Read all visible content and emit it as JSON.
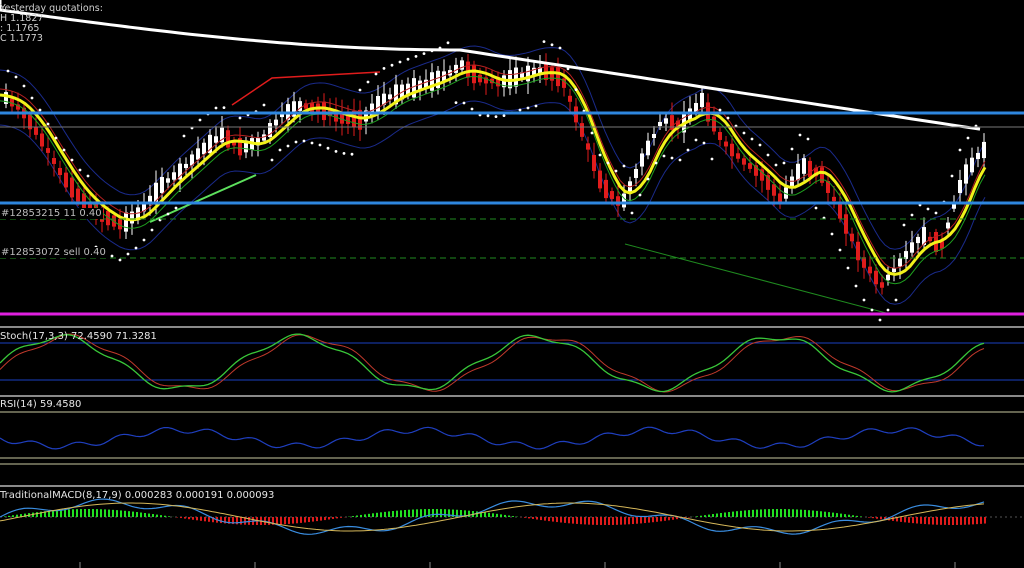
{
  "quotations": {
    "title": "Yesterday quotations:",
    "high": "H 1.1827",
    "low": ": 1.1765",
    "close": "C 1.1773"
  },
  "orders": [
    {
      "id": "#12853215",
      "side_label": "#12853215",
      "suffix": "11 0.40",
      "color": "#1f8a1f"
    },
    {
      "id": "#12853072",
      "side_label": "#12853072 sell 0.40",
      "color": "#1f8a1f"
    }
  ],
  "indicators": {
    "stoch": "Stoch(17,3,3) 72.4590 71.3281",
    "rsi": "RSI(14) 59.4580",
    "macd": "TraditionalMACD(8,17,9) 0.000283 0.000191 0.000093"
  },
  "colors": {
    "background": "#000000",
    "bull_candle": "#ffffff",
    "bear_candle": "#e01c1c",
    "ema_fast": "#f2f21a",
    "ema_slow": "#ffffff",
    "level_blue": "#2e86de",
    "level_magenta": "#e020e0",
    "psar": "#ffffff",
    "stoch_main": "#39c739",
    "stoch_signal": "#c0392b",
    "rsi_line": "#1f3fbf",
    "macd_line": "#3a8de0",
    "macd_signal": "#d6b85a"
  }
}
